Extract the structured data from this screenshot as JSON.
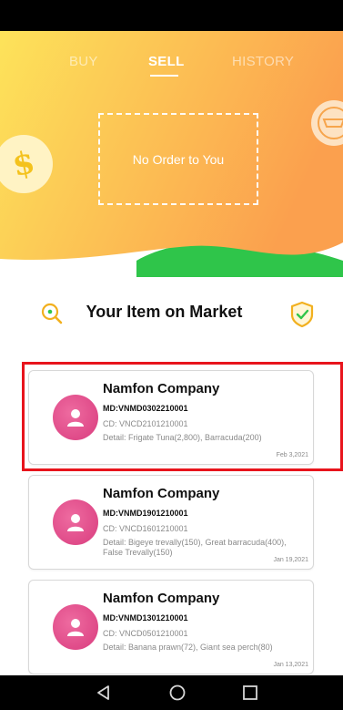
{
  "tabs": [
    {
      "label": "BUY",
      "active": false
    },
    {
      "label": "SELL",
      "active": true
    },
    {
      "label": "HISTORY",
      "active": false
    }
  ],
  "hero": {
    "empty_message": "No Order to You",
    "gradient": {
      "from": "#fde35a",
      "to": "#fba04e"
    },
    "wave_color": "#2fc54a"
  },
  "market": {
    "title": "Your Item on Market",
    "left_icon": "search-icon",
    "right_icon": "shield-check-icon"
  },
  "cards": [
    {
      "company": "Namfon Company",
      "md": "MD:VNMD0302210001",
      "cd": "CD: VNCD2101210001",
      "detail": "Detail: Frigate Tuna(2,800), Barracuda(200)",
      "date": "Feb 3,2021",
      "highlighted": true
    },
    {
      "company": "Namfon Company",
      "md": "MD:VNMD1901210001",
      "cd": "CD: VNCD1601210001",
      "detail": "Detail: Bigeye trevally(150), Great barracuda(400), False Trevally(150)",
      "date": "Jan 19,2021",
      "highlighted": false
    },
    {
      "company": "Namfon Company",
      "md": "MD:VNMD1301210001",
      "cd": "CD: VNCD0501210001",
      "detail": "Detail: Banana prawn(72), Giant sea perch(80)",
      "date": "Jan 13,2021",
      "highlighted": false
    }
  ],
  "colors": {
    "avatar": "#e2508c",
    "highlight_border": "#e8141c",
    "shield": "#f2b01e"
  },
  "system_nav": [
    "back-icon",
    "home-icon",
    "recents-icon"
  ]
}
